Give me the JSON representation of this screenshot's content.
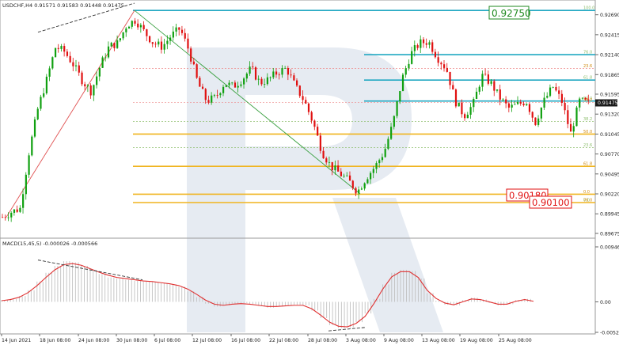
{
  "chart_data": [
    {
      "type": "candlestick",
      "title": "USDCHF,H4  0.91571 0.91583 0.91448 0.91475",
      "symbol": "USDCHF,H4",
      "ohlc_header": "0.91571 0.91583 0.91448 0.91475",
      "ylim": [
        0.8962,
        0.9285
      ],
      "y_ticks": [
        0.9269,
        0.92415,
        0.9214,
        0.91865,
        0.91595,
        0.9132,
        0.91045,
        0.9077,
        0.90495,
        0.9022,
        0.89945,
        0.89675
      ],
      "current_price": "0.91475",
      "x_tick_labels": [
        "14 Jun 2021",
        "18 Jun 08:00",
        "24 Jun 08:00",
        "30 Jun 08:00",
        "6 Jul 08:00",
        "12 Jul 08:00",
        "16 Jul 08:00",
        "22 Jul 08:00",
        "28 Jul 08:00",
        "3 Aug 08:00",
        "9 Aug 08:00",
        "13 Aug 08:00",
        "19 Aug 08:00",
        "25 Aug 08:00"
      ],
      "price_path": [
        [
          0,
          0.899
        ],
        [
          3,
          0.8997
        ],
        [
          6,
          0.9002
        ],
        [
          9,
          0.908
        ],
        [
          12,
          0.914
        ],
        [
          15,
          0.918
        ],
        [
          18,
          0.9225
        ],
        [
          21,
          0.9218
        ],
        [
          24,
          0.92
        ],
        [
          27,
          0.9178
        ],
        [
          30,
          0.9163
        ],
        [
          33,
          0.9198
        ],
        [
          36,
          0.9225
        ],
        [
          39,
          0.923
        ],
        [
          42,
          0.9255
        ],
        [
          45,
          0.9262
        ],
        [
          48,
          0.9245
        ],
        [
          51,
          0.923
        ],
        [
          54,
          0.9225
        ],
        [
          57,
          0.924
        ],
        [
          60,
          0.925
        ],
        [
          63,
          0.922
        ],
        [
          66,
          0.9175
        ],
        [
          69,
          0.915
        ],
        [
          72,
          0.9155
        ],
        [
          75,
          0.9175
        ],
        [
          78,
          0.917
        ],
        [
          81,
          0.918
        ],
        [
          84,
          0.9195
        ],
        [
          87,
          0.9175
        ],
        [
          90,
          0.918
        ],
        [
          93,
          0.919
        ],
        [
          96,
          0.9195
        ],
        [
          99,
          0.917
        ],
        [
          102,
          0.915
        ],
        [
          105,
          0.912
        ],
        [
          108,
          0.908
        ],
        [
          111,
          0.906
        ],
        [
          114,
          0.905
        ],
        [
          117,
          0.904
        ],
        [
          120,
          0.9025
        ],
        [
          123,
          0.9045
        ],
        [
          126,
          0.906
        ],
        [
          129,
          0.908
        ],
        [
          132,
          0.912
        ],
        [
          135,
          0.918
        ],
        [
          138,
          0.9215
        ],
        [
          141,
          0.923
        ],
        [
          144,
          0.9232
        ],
        [
          147,
          0.921
        ],
        [
          150,
          0.9195
        ],
        [
          153,
          0.915
        ],
        [
          156,
          0.913
        ],
        [
          159,
          0.9145
        ],
        [
          162,
          0.9185
        ],
        [
          165,
          0.9175
        ],
        [
          168,
          0.9155
        ],
        [
          171,
          0.914
        ],
        [
          174,
          0.9145
        ],
        [
          177,
          0.915
        ],
        [
          180,
          0.912
        ],
        [
          183,
          0.915
        ],
        [
          186,
          0.917
        ],
        [
          189,
          0.915
        ],
        [
          192,
          0.9105
        ],
        [
          195,
          0.915
        ],
        [
          198,
          0.9148
        ]
      ],
      "fibonacci_retracement": [
        {
          "level": "100.0",
          "price": 0.9275
        },
        {
          "level": "76.0",
          "price": 0.9214
        },
        {
          "level": "61.8",
          "price": 0.9179
        },
        {
          "level": "50.0",
          "price": 0.915
        },
        {
          "level": "38.2",
          "price": 0.9122
        },
        {
          "level": "23.6",
          "price": 0.9086
        },
        {
          "level": "0.0",
          "price": 0.901
        }
      ],
      "fibonacci_extension": [
        {
          "level": "0.0",
          "price": 0.90215
        },
        {
          "level": "23.6",
          "price": 0.9195
        },
        {
          "level": "38.2",
          "price": 0.9148
        },
        {
          "level": "50.0",
          "price": 0.91045
        },
        {
          "level": "61.8",
          "price": 0.906
        },
        {
          "level": "76.0",
          "price": 0.901
        }
      ],
      "price_labels": [
        "0.92750",
        "0.90180",
        "0.90100"
      ]
    },
    {
      "type": "histogram",
      "title": "MACD(15,45,5) -0.000026 -0.000566",
      "indicator_name": "MACD(15,45,5)",
      "indicator_values": "-0.000026 -0.000566",
      "y_ticks": [
        "0.009465",
        "0.00",
        "-0.005251"
      ],
      "ylim": [
        -0.005251,
        0.009465
      ],
      "histogram": [
        0.0003,
        0.0005,
        0.001,
        0.002,
        0.0035,
        0.005,
        0.0062,
        0.007,
        0.0068,
        0.0062,
        0.0055,
        0.0048,
        0.0042,
        0.004,
        0.0038,
        0.0036,
        0.0035,
        0.0034,
        0.0032,
        0.003,
        0.0026,
        0.0018,
        0.0008,
        -0.0003,
        -0.0008,
        -0.0006,
        -0.0003,
        -0.0002,
        -0.0004,
        -0.0007,
        -0.001,
        -0.0008,
        -0.0006,
        -0.0005,
        -0.0006,
        -0.0015,
        -0.0028,
        -0.004,
        -0.0045,
        -0.0044,
        -0.0035,
        -0.002,
        0.0005,
        0.003,
        0.005,
        0.0055,
        0.0053,
        0.004,
        0.0015,
        0.0002,
        -0.0005,
        -0.0006,
        0.0003,
        0.0007,
        0.0004,
        -0.0002,
        -0.0006,
        -0.0004,
        0.0003,
        0.0005,
        0.0
      ],
      "signal": [
        0.0002,
        0.0004,
        0.0008,
        0.0016,
        0.0028,
        0.0042,
        0.0055,
        0.0064,
        0.0066,
        0.0063,
        0.0057,
        0.0051,
        0.0046,
        0.0042,
        0.004,
        0.0038,
        0.0036,
        0.0035,
        0.0033,
        0.0031,
        0.0028,
        0.0022,
        0.0013,
        0.0003,
        -0.0004,
        -0.0006,
        -0.0004,
        -0.0003,
        -0.0004,
        -0.0006,
        -0.0008,
        -0.0008,
        -0.0007,
        -0.0006,
        -0.0006,
        -0.0012,
        -0.0023,
        -0.0035,
        -0.0042,
        -0.0043,
        -0.0037,
        -0.0025,
        -0.0003,
        0.0022,
        0.0043,
        0.0052,
        0.0052,
        0.0042,
        0.002,
        0.0006,
        -0.0002,
        -0.0005,
        0.0,
        0.0005,
        0.0004,
        0.0,
        -0.0004,
        -0.0004,
        0.0001,
        0.0004,
        0.0001
      ]
    }
  ],
  "colors": {
    "bull": "#10a010",
    "bear": "#e01010",
    "fib_main": "#21a8c2",
    "fib_retrace": "#8fbf6f",
    "fib_ext": "#f0b41e",
    "watermark": "#e6ebf2",
    "macd_line": "#e03030",
    "macd_hist": "#c0c0c0",
    "label_green": "#1f8a1f",
    "label_red": "#e01010"
  }
}
